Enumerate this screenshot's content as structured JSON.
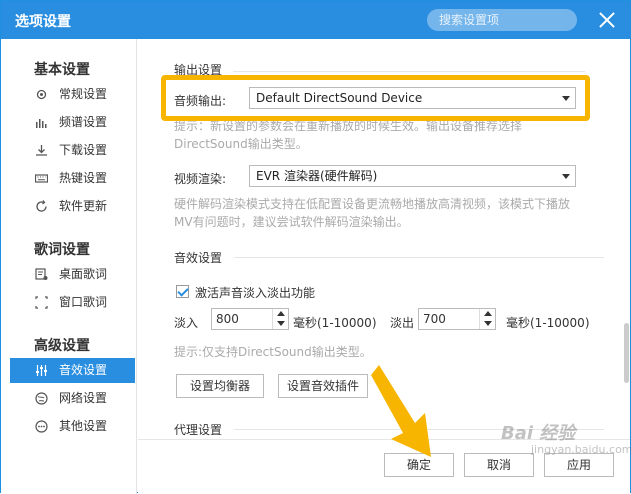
{
  "window": {
    "title": "选项设置",
    "search_placeholder": "搜索设置项"
  },
  "sidebar": {
    "groups": [
      {
        "label": "基本设置",
        "items": [
          "常规设置",
          "频谱设置",
          "下载设置",
          "热键设置",
          "软件更新"
        ]
      },
      {
        "label": "歌词设置",
        "items": [
          "桌面歌词",
          "窗口歌词"
        ]
      },
      {
        "label": "高级设置",
        "items": [
          "音效设置",
          "网络设置",
          "其他设置"
        ]
      }
    ],
    "selected": "音效设置"
  },
  "output": {
    "section_title": "输出设置",
    "audio_label": "音频输出:",
    "audio_value": "Default DirectSound Device",
    "hint": "提示：新设置的参数会在重新播放的时候生效。输出设备推荐选择DirectSound输出类型。",
    "video_label": "视频渲染:",
    "video_value": "EVR 渲染器(硬件解码)",
    "video_hint": "硬件解码渲染模式支持在低配置设备更流畅地播放高清视频，该模式下播放MV有问题时，建议尝试软件解码渲染输出。"
  },
  "effects": {
    "section_title": "音效设置",
    "fade_checkbox_label": "激活声音淡入淡出功能",
    "fade_checked": true,
    "fade_in_label": "淡入",
    "fade_in_value": "800",
    "fade_in_unit": "毫秒(1-10000)",
    "fade_out_label": "淡出",
    "fade_out_value": "700",
    "fade_out_unit": "毫秒(1-10000)",
    "hint": "提示:仅支持DirectSound输出类型。",
    "equalizer_button": "设置均衡器",
    "plugin_button": "设置音效插件"
  },
  "proxy": {
    "section_title": "代理设置"
  },
  "footer": {
    "ok": "确定",
    "cancel": "取消",
    "apply": "应用"
  },
  "watermark": {
    "text": "Bai 经验",
    "sub": "jingyan.baidu.com"
  },
  "colors": {
    "accent": "#2a8ee0",
    "highlight": "#f7b500"
  }
}
